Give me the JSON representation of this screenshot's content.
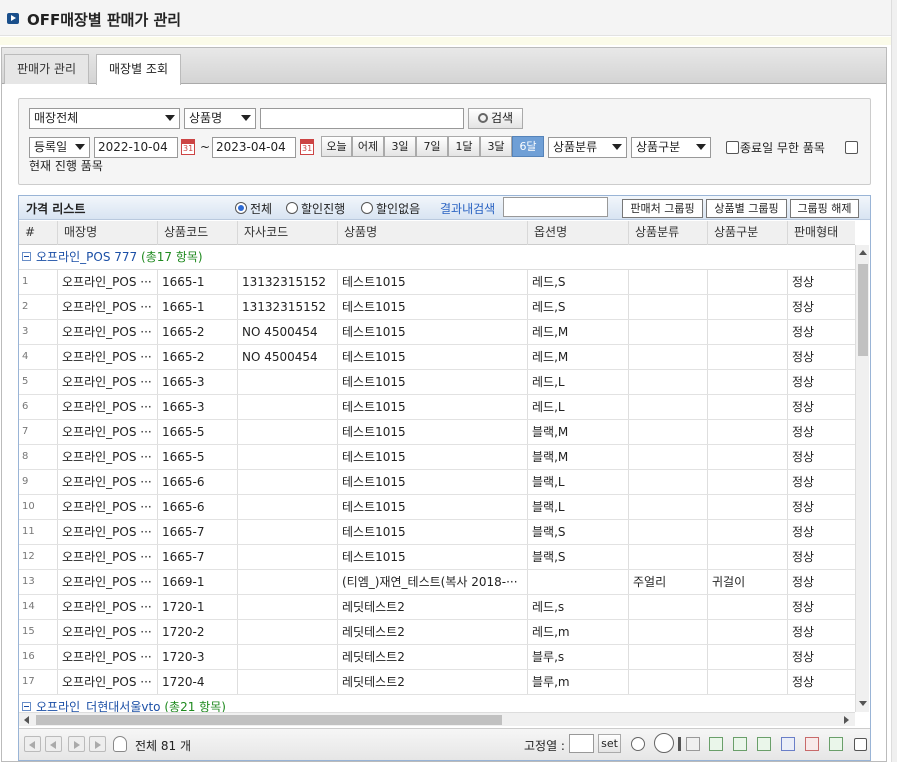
{
  "header": {
    "title": "OFF매장별 판매가 관리"
  },
  "tabs": [
    {
      "label": "판매가 관리",
      "active": false
    },
    {
      "label": "매장별 조회",
      "active": true
    }
  ],
  "search": {
    "store_select": "매장전체",
    "field_select": "상품명",
    "keyword_value": "",
    "search_button": "검색",
    "date_type_select": "등록일",
    "date_from": "2022-10-04",
    "date_sep": "~",
    "date_to": "2023-04-04",
    "calendar_label": "31",
    "quick_ranges": [
      "오늘",
      "어제",
      "3일",
      "7일",
      "1달",
      "3달",
      "6달"
    ],
    "active_range": "6달",
    "category_select": "상품분류",
    "type_select": "상품구분",
    "unlimited_end_label": "종료일 무한 품목",
    "current_label": "현재 진행 품목"
  },
  "grid": {
    "title": "가격 리스트",
    "radios": [
      {
        "label": "전체",
        "checked": true
      },
      {
        "label": "할인진행",
        "checked": false
      },
      {
        "label": "할인없음",
        "checked": false
      }
    ],
    "result_search_label": "결과내검색",
    "result_search_value": "",
    "buttons": [
      "판매처 그룹핑",
      "상품별 그룹핑",
      "그룹핑 해제"
    ],
    "columns": [
      "#",
      "매장명",
      "상품코드",
      "자사코드",
      "상품명",
      "옵션명",
      "상품분류",
      "상품구분",
      "판매형태"
    ],
    "groups": [
      {
        "label": "오프라인_POS 777",
        "count": "(총17 항목)"
      },
      {
        "label": "오프라인_더현대서울vto",
        "count": "(총21 항목)"
      }
    ],
    "rows": [
      {
        "no": "1",
        "store": "오프라인_POS ···",
        "code": "1665-1",
        "own": "13132315152",
        "name": "테스트1015",
        "option": "레드,S",
        "cat": "",
        "type": "",
        "sale": "정상"
      },
      {
        "no": "2",
        "store": "오프라인_POS ···",
        "code": "1665-1",
        "own": "13132315152",
        "name": "테스트1015",
        "option": "레드,S",
        "cat": "",
        "type": "",
        "sale": "정상"
      },
      {
        "no": "3",
        "store": "오프라인_POS ···",
        "code": "1665-2",
        "own": "NO 4500454",
        "name": "테스트1015",
        "option": "레드,M",
        "cat": "",
        "type": "",
        "sale": "정상"
      },
      {
        "no": "4",
        "store": "오프라인_POS ···",
        "code": "1665-2",
        "own": "NO 4500454",
        "name": "테스트1015",
        "option": "레드,M",
        "cat": "",
        "type": "",
        "sale": "정상"
      },
      {
        "no": "5",
        "store": "오프라인_POS ···",
        "code": "1665-3",
        "own": "",
        "name": "테스트1015",
        "option": "레드,L",
        "cat": "",
        "type": "",
        "sale": "정상"
      },
      {
        "no": "6",
        "store": "오프라인_POS ···",
        "code": "1665-3",
        "own": "",
        "name": "테스트1015",
        "option": "레드,L",
        "cat": "",
        "type": "",
        "sale": "정상"
      },
      {
        "no": "7",
        "store": "오프라인_POS ···",
        "code": "1665-5",
        "own": "",
        "name": "테스트1015",
        "option": "블랙,M",
        "cat": "",
        "type": "",
        "sale": "정상"
      },
      {
        "no": "8",
        "store": "오프라인_POS ···",
        "code": "1665-5",
        "own": "",
        "name": "테스트1015",
        "option": "블랙,M",
        "cat": "",
        "type": "",
        "sale": "정상"
      },
      {
        "no": "9",
        "store": "오프라인_POS ···",
        "code": "1665-6",
        "own": "",
        "name": "테스트1015",
        "option": "블랙,L",
        "cat": "",
        "type": "",
        "sale": "정상"
      },
      {
        "no": "10",
        "store": "오프라인_POS ···",
        "code": "1665-6",
        "own": "",
        "name": "테스트1015",
        "option": "블랙,L",
        "cat": "",
        "type": "",
        "sale": "정상"
      },
      {
        "no": "11",
        "store": "오프라인_POS ···",
        "code": "1665-7",
        "own": "",
        "name": "테스트1015",
        "option": "블랙,S",
        "cat": "",
        "type": "",
        "sale": "정상"
      },
      {
        "no": "12",
        "store": "오프라인_POS ···",
        "code": "1665-7",
        "own": "",
        "name": "테스트1015",
        "option": "블랙,S",
        "cat": "",
        "type": "",
        "sale": "정상"
      },
      {
        "no": "13",
        "store": "오프라인_POS ···",
        "code": "1669-1",
        "own": "",
        "name": "(티엠_)재연_테스트(복사 2018-···",
        "option": "",
        "cat": "주얼리",
        "type": "귀걸이",
        "sale": "정상"
      },
      {
        "no": "14",
        "store": "오프라인_POS ···",
        "code": "1720-1",
        "own": "",
        "name": "레딧테스트2",
        "option": "레드,s",
        "cat": "",
        "type": "",
        "sale": "정상"
      },
      {
        "no": "15",
        "store": "오프라인_POS ···",
        "code": "1720-2",
        "own": "",
        "name": "레딧테스트2",
        "option": "레드,m",
        "cat": "",
        "type": "",
        "sale": "정상"
      },
      {
        "no": "16",
        "store": "오프라인_POS ···",
        "code": "1720-3",
        "own": "",
        "name": "레딧테스트2",
        "option": "블루,s",
        "cat": "",
        "type": "",
        "sale": "정상"
      },
      {
        "no": "17",
        "store": "오프라인_POS ···",
        "code": "1720-4",
        "own": "",
        "name": "레딧테스트2",
        "option": "블루,m",
        "cat": "",
        "type": "",
        "sale": "정상"
      }
    ],
    "footer": {
      "total": "전체 81 개",
      "fixed_col_label": "고정열 :",
      "fixed_col_value": "",
      "set_button": "set"
    }
  }
}
